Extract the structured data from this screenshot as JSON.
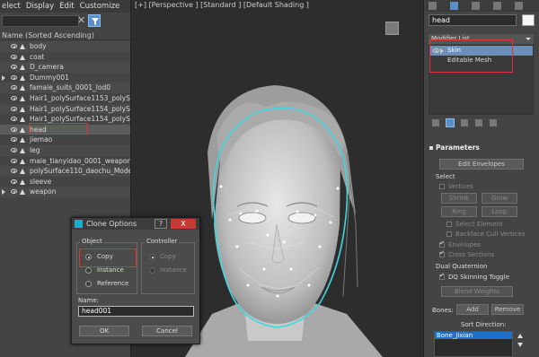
{
  "menu": [
    "elect",
    "Display",
    "Edit",
    "Customize"
  ],
  "filter": {
    "value": "",
    "clear_icon": "close-icon",
    "filter_icon": "filter-icon"
  },
  "scene_explorer": {
    "column_header": "Name (Sorted Ascending)",
    "items": [
      {
        "label": "body",
        "expandable": false,
        "selected": false
      },
      {
        "label": "coat",
        "expandable": false,
        "selected": false
      },
      {
        "label": "D_camera",
        "expandable": false,
        "selected": false
      },
      {
        "label": "Dummy001",
        "expandable": true,
        "selected": false
      },
      {
        "label": "famale_suits_0001_lod0",
        "expandable": false,
        "selected": false
      },
      {
        "label": "Hair1_polySurface1153_polySu",
        "expandable": false,
        "selected": false
      },
      {
        "label": "Hair1_polySurface1154_polySu",
        "expandable": false,
        "selected": false
      },
      {
        "label": "Hair1_polySurface1154_polySu",
        "expandable": false,
        "selected": false
      },
      {
        "label": "head",
        "expandable": false,
        "selected": true
      },
      {
        "label": "jiemao",
        "expandable": false,
        "selected": false
      },
      {
        "label": "leg",
        "expandable": false,
        "selected": false
      },
      {
        "label": "male_tianyidao_0001_weapon",
        "expandable": false,
        "selected": false
      },
      {
        "label": "polySurface110_daochu_Mode",
        "expandable": false,
        "selected": false
      },
      {
        "label": "sleeve",
        "expandable": false,
        "selected": false
      },
      {
        "label": "weapon",
        "expandable": true,
        "selected": false
      }
    ]
  },
  "viewport": {
    "label": "[+] [Perspective ] [Standard ] [Default Shading ]"
  },
  "command_panel": {
    "object_name": "head",
    "object_color": "#f4f4f4",
    "modifier_list_label": "Modifier List",
    "modifier_stack": [
      {
        "label": "Skin",
        "selected": true,
        "expandable": true
      },
      {
        "label": "Editable Mesh",
        "selected": false,
        "expandable": false
      }
    ],
    "parameters": {
      "header": "Parameters",
      "edit_envelopes": "Edit Envelopes",
      "select_label": "Select",
      "vertices_label": "Vertices",
      "shrink": "Shrink",
      "grow": "Grow",
      "ring": "Ring",
      "loop": "Loop",
      "select_element": "Select Element",
      "backface_cull": "Backface Cull Vertices",
      "envelopes": "Envelopes",
      "cross_sections": "Cross Sections",
      "dual_quaternion": "Dual Quaternion",
      "dq_toggle": "DQ Skinning Toggle",
      "blend_weights": "Blend Weights",
      "bones_label": "Bones:",
      "add": "Add",
      "remove": "Remove",
      "sort_direction": "Sort Direction:",
      "bones_list": [
        "Bone_Jixian"
      ]
    }
  },
  "clone_dialog": {
    "title": "Clone Options",
    "help": "?",
    "close": "X",
    "object_group": "Object",
    "controller_group": "Controller",
    "object_options": [
      {
        "label": "Copy",
        "checked": true
      },
      {
        "label": "Instance",
        "checked": false
      },
      {
        "label": "Reference",
        "checked": false
      }
    ],
    "controller_options": [
      {
        "label": "Copy",
        "checked": true
      },
      {
        "label": "Instance",
        "checked": false
      }
    ],
    "name_label": "Name:",
    "name_value": "head001",
    "ok": "OK",
    "cancel": "Cancel"
  },
  "colors": {
    "highlight": "#e0323a",
    "selection_blue": "#5a8fc8",
    "envelope_cyan": "#3fd6e0"
  }
}
